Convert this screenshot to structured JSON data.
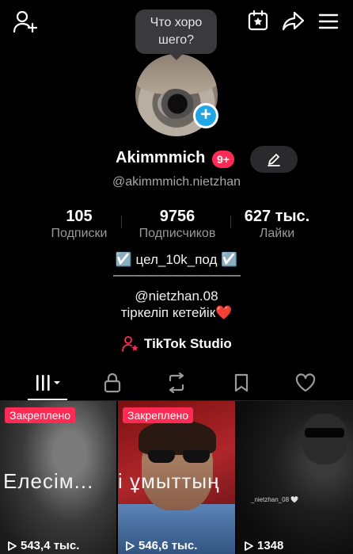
{
  "tooltip": {
    "text_line1": "Что хоро",
    "text_line2": "шего?"
  },
  "profile": {
    "username": "Akimmmich",
    "notifications_badge": "9+",
    "handle": "@akimmmich.nietzhan"
  },
  "stats": [
    {
      "value": "105",
      "label": "Подписки"
    },
    {
      "value": "9756",
      "label": "Подписчиков"
    },
    {
      "value": "627 тыс.",
      "label": "Лайки"
    }
  ],
  "bio": {
    "line1": "☑️ цел_10k_под ☑️",
    "line2": "——————————",
    "line3": "@nietzhan.08",
    "line4": "тіркеліп кетейік❤️"
  },
  "studio_link": "TikTok Studio",
  "tabs": [
    "videos-grid",
    "private",
    "reposts",
    "favorites",
    "liked"
  ],
  "videos": [
    {
      "pinned_label": "Закреплено",
      "overlay": "Елесім...",
      "views": "543,4 тыс."
    },
    {
      "pinned_label": "Закреплено",
      "overlay": "і ұмыттың",
      "views": "546,6 тыс."
    },
    {
      "pinned_label": "",
      "overlay": "",
      "watermark": "_nietzhan_08 🤍",
      "views": "1348"
    }
  ],
  "colors": {
    "accent": "#fe2c55",
    "plus_badge": "#20a6e6",
    "background": "#000000"
  }
}
